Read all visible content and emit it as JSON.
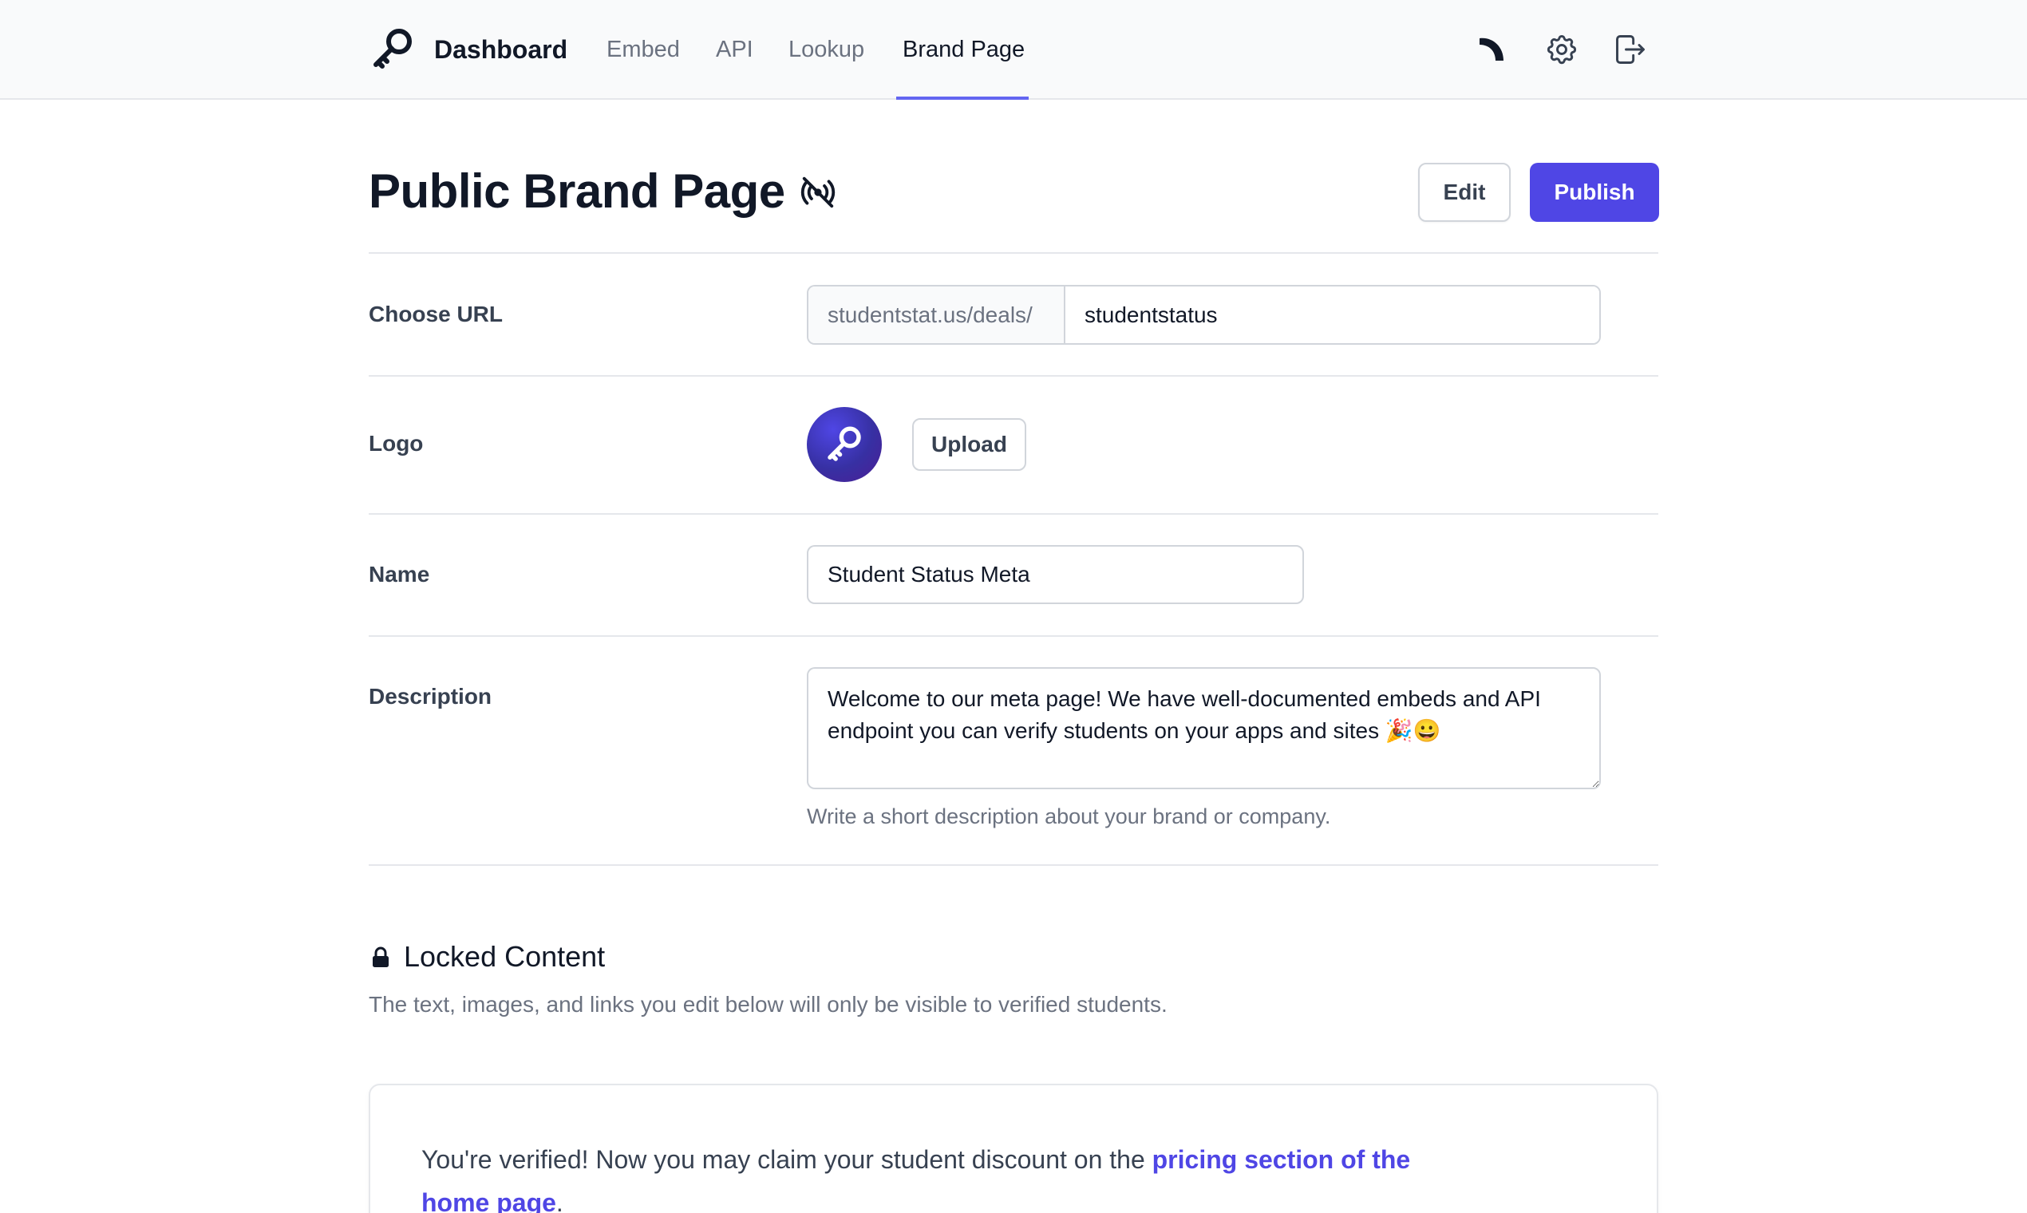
{
  "header": {
    "brand_title": "Dashboard",
    "nav": [
      {
        "label": "Embed",
        "active": false
      },
      {
        "label": "API",
        "active": false
      },
      {
        "label": "Lookup",
        "active": false
      },
      {
        "label": "Brand Page",
        "active": true
      }
    ],
    "icons": [
      "key-icon",
      "theme-toggle-icon",
      "settings-gear-icon",
      "logout-icon"
    ]
  },
  "page": {
    "title": "Public Brand Page",
    "status_icon": "broadcast-off-icon",
    "edit_label": "Edit",
    "publish_label": "Publish"
  },
  "form": {
    "url": {
      "label": "Choose URL",
      "prefix": "studentstat.us/deals/",
      "value": "studentstatus"
    },
    "logo": {
      "label": "Logo",
      "upload_label": "Upload"
    },
    "name": {
      "label": "Name",
      "value": "Student Status Meta"
    },
    "description": {
      "label": "Description",
      "value": "Welcome to our meta page! We have well-documented embeds and API endpoint you can verify students on your apps and sites 🎉😀",
      "help": "Write a short description about your brand or company."
    }
  },
  "locked": {
    "title": "Locked Content",
    "subtitle": "The text, images, and links you edit below will only be visible to verified students.",
    "text_before": "You're verified! Now you may claim your student discount on the ",
    "link_text": "pricing section of the home page",
    "text_after": "."
  },
  "colors": {
    "accent": "#4f46e5",
    "nav_active_underline": "#6366f1",
    "topbar_bg": "#f9fafb"
  }
}
